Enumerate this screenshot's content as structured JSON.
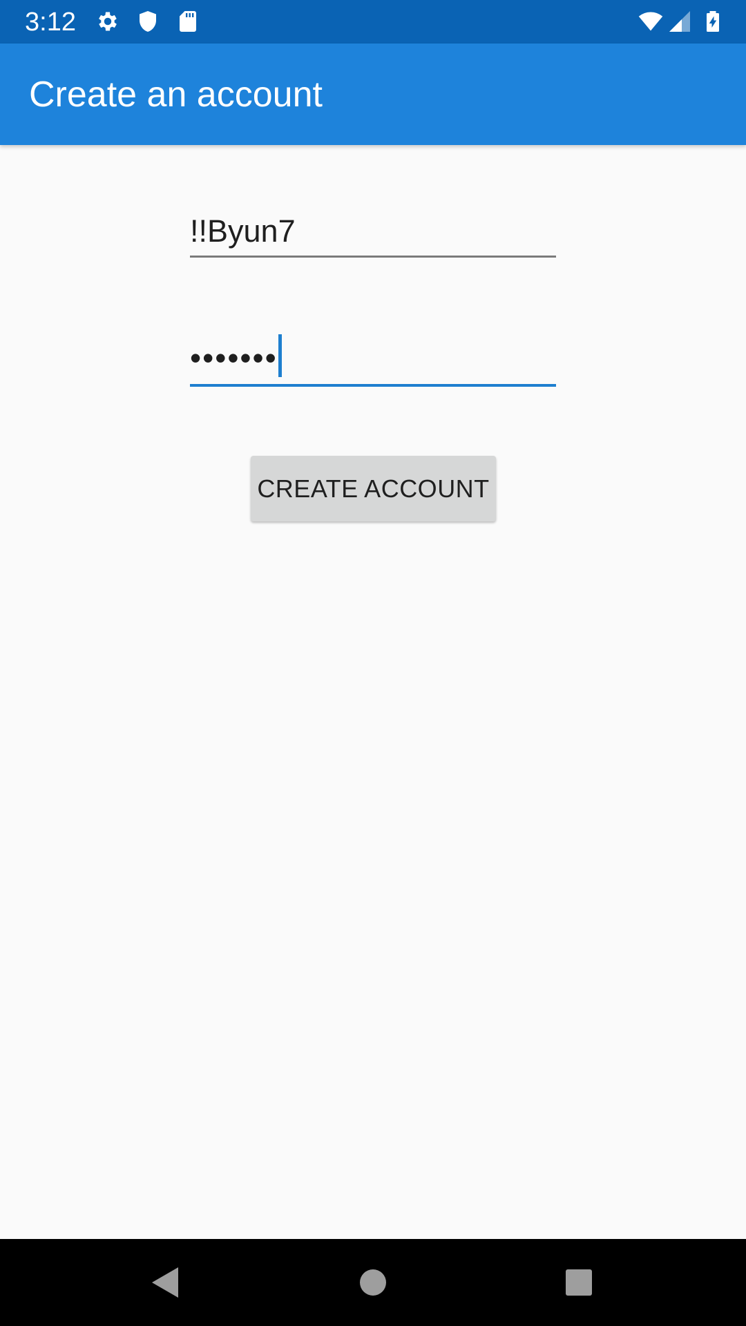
{
  "status_bar": {
    "time": "3:12",
    "icons": [
      "settings-gear-icon",
      "shield-icon",
      "sd-card-icon",
      "wifi-icon",
      "cell-signal-icon",
      "battery-charging-icon"
    ]
  },
  "app_bar": {
    "title": "Create an account"
  },
  "form": {
    "username_value": "!!Byun7",
    "password_value": "•••••••",
    "create_button_label": "CREATE ACCOUNT"
  },
  "nav_bar": {
    "buttons": [
      "back-icon",
      "home-icon",
      "recents-icon"
    ]
  },
  "colors": {
    "status_bar": "#0a63b4",
    "app_bar": "#1e83db",
    "accent": "#1e7fcf",
    "background": "#fafafa",
    "button": "#d6d7d7"
  }
}
